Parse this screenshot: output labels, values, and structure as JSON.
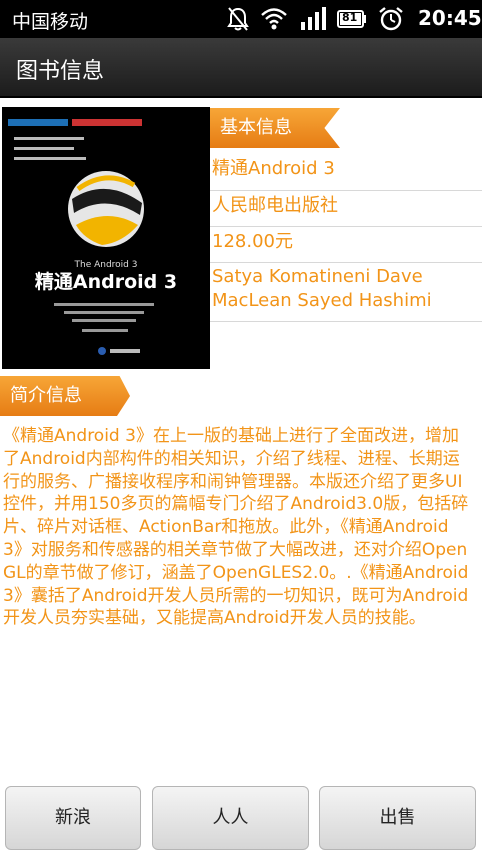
{
  "status_bar": {
    "carrier": "中国移动",
    "battery": "81",
    "time": "20:45",
    "icons": [
      "mute-icon",
      "wifi-icon",
      "signal-icon",
      "battery-icon",
      "alarm-icon"
    ]
  },
  "header": {
    "title": "图书信息"
  },
  "cover": {
    "top_label": "The Android 3",
    "book_title": "精通Android 3"
  },
  "basic_section": {
    "label": "基本信息",
    "title": "精通Android 3",
    "publisher": "人民邮电出版社",
    "price": "128.00元",
    "authors": "Satya Komatineni Dave MacLean Sayed Hashimi"
  },
  "intro_section": {
    "label": "简介信息",
    "text": "《精通Android 3》在上一版的基础上进行了全面改进，增加了Android内部构件的相关知识，介绍了线程、进程、长期运行的服务、广播接收程序和闹钟管理器。本版还介绍了更多UI控件，并用150多页的篇幅专门介绍了Android3.0版，包括碎片、碎片对话框、ActionBar和拖放。此外，《精通Android 3》对服务和传感器的相关章节做了大幅改进，还对介绍OpenGL的章节做了修订，涵盖了OpenGLES2.0。.《精通Android 3》囊括了Android开发人员所需的一切知识，既可为Android开发人员夯实基础，又能提高Android开发人员的技能。"
  },
  "buttons": {
    "sina": "新浪",
    "renren": "人人",
    "buy": "出售"
  },
  "colors": {
    "accent": "#f29418",
    "ribbon": "#f39a2a",
    "title_bar": "#2a2a2a"
  }
}
